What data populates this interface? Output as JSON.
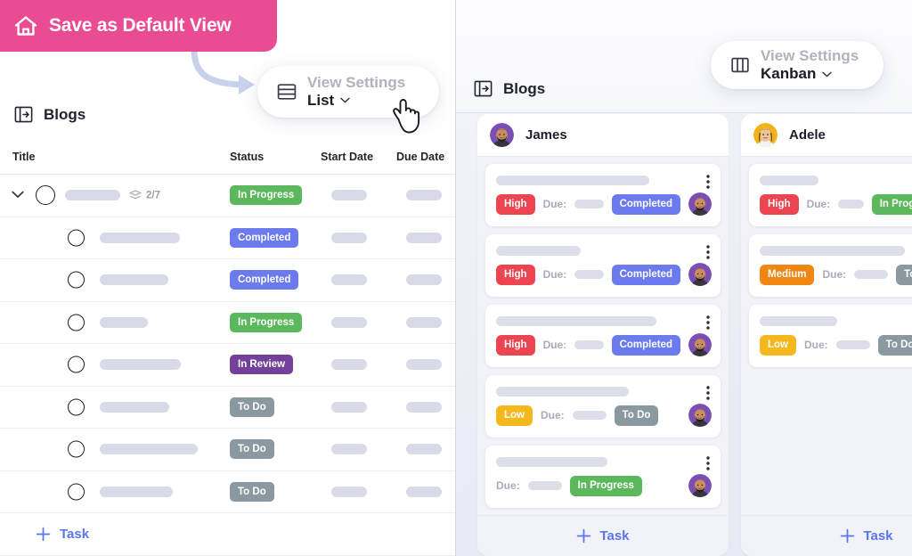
{
  "left": {
    "banner": {
      "label": "Save as Default View",
      "icon": "home-icon",
      "bg": "#ea4c94"
    },
    "view_pill": {
      "caption": "View Settings",
      "value": "List",
      "icon": "list-rows-icon",
      "chevron": "chevron-down-icon"
    },
    "blogs": {
      "title": "Blogs",
      "icon": "panel-expand-icon"
    },
    "columns": [
      "Title",
      "Status",
      "Start Date",
      "Due Date"
    ],
    "rows": [
      {
        "kind": "parent",
        "status": "In Progress",
        "status_color": "#5cb85c",
        "subtasks": "2/7",
        "title_width": 62
      },
      {
        "kind": "child",
        "status": "Completed",
        "status_color": "#6b7bee",
        "title_width": 90
      },
      {
        "kind": "child",
        "status": "Completed",
        "status_color": "#6b7bee",
        "title_width": 77
      },
      {
        "kind": "child",
        "status": "In Progress",
        "status_color": "#5cb85c",
        "title_width": 54
      },
      {
        "kind": "child",
        "status": "In Review",
        "status_color": "#73409b",
        "title_width": 91
      },
      {
        "kind": "child",
        "status": "To Do",
        "status_color": "#89999f",
        "title_width": 78
      },
      {
        "kind": "child",
        "status": "To Do",
        "status_color": "#89999f",
        "title_width": 110
      },
      {
        "kind": "child",
        "status": "To Do",
        "status_color": "#89999f",
        "title_width": 82
      }
    ],
    "add_task": {
      "label": "Task",
      "icon": "plus-icon",
      "color": "#5b74f0"
    }
  },
  "right": {
    "view_pill": {
      "caption": "View Settings",
      "value": "Kanban",
      "icon": "kanban-columns-icon",
      "chevron": "chevron-down-icon"
    },
    "blogs": {
      "title": "Blogs",
      "icon": "panel-expand-icon"
    },
    "add_task": {
      "label": "Task",
      "icon": "plus-icon",
      "color": "#5b74f0"
    },
    "due_label": "Due:",
    "columns": [
      {
        "name": "James",
        "avatar_color": "#7a4fb5",
        "cards": [
          {
            "title_width": 172,
            "priority": "High",
            "priority_color": "#ec4450",
            "status": "Completed",
            "status_color": "#6b7bee"
          },
          {
            "title_width": 95,
            "priority": "High",
            "priority_color": "#ec4450",
            "status": "Completed",
            "status_color": "#6b7bee"
          },
          {
            "title_width": 180,
            "priority": "High",
            "priority_color": "#ec4450",
            "status": "Completed",
            "status_color": "#6b7bee"
          },
          {
            "title_width": 149,
            "priority": "Low",
            "priority_color": "#f5b81c",
            "status": "To Do",
            "status_color": "#89999f"
          },
          {
            "title_width": 125,
            "priority": "",
            "priority_color": "",
            "status": "In Progress",
            "status_color": "#5cb85c"
          }
        ]
      },
      {
        "name": "Adele",
        "avatar_color": "#f2b318",
        "cards": [
          {
            "title_width": 66,
            "priority": "High",
            "priority_color": "#ec4450",
            "status": "In Progress",
            "status_color": "#5cb85c"
          },
          {
            "title_width": 163,
            "priority": "Medium",
            "priority_color": "#f08713",
            "status": "To Do",
            "status_color": "#89999f"
          },
          {
            "title_width": 87,
            "priority": "Low",
            "priority_color": "#f5b81c",
            "status": "To Do",
            "status_color": "#89999f"
          }
        ]
      }
    ]
  }
}
